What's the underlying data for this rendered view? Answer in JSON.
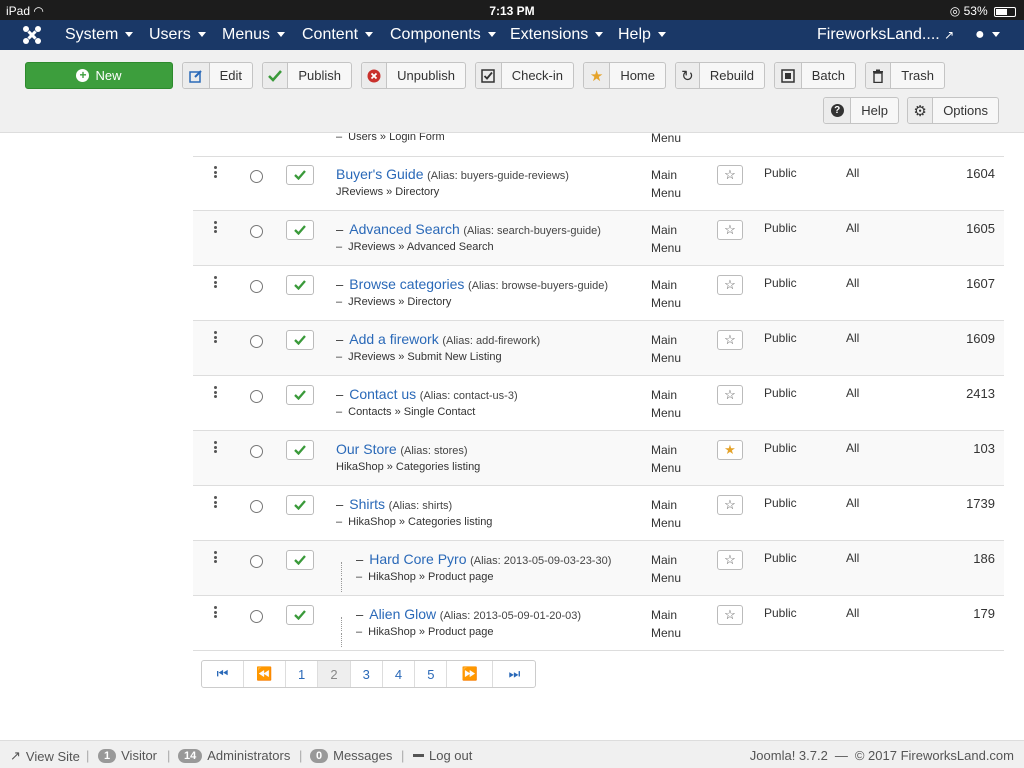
{
  "statusbar": {
    "device": "iPad",
    "time": "7:13 PM",
    "battery": "53%"
  },
  "nav": {
    "menus": [
      "System",
      "Users",
      "Menus",
      "Content",
      "Components",
      "Extensions",
      "Help"
    ],
    "site": "FireworksLand...."
  },
  "toolbar": {
    "new": "New",
    "edit": "Edit",
    "publish": "Publish",
    "unpublish": "Unpublish",
    "checkin": "Check-in",
    "home": "Home",
    "rebuild": "Rebuild",
    "batch": "Batch",
    "trash": "Trash",
    "help": "Help",
    "options": "Options"
  },
  "partial_row": {
    "sub": "Users » Login Form",
    "menu": "Menu"
  },
  "rows": [
    {
      "indent": 0,
      "title": "Buyer's Guide",
      "alias": "(Alias: buyers-guide-reviews)",
      "sub": "JReviews » Directory",
      "menu": [
        "Main",
        "Menu"
      ],
      "home": false,
      "access": "Public",
      "lang": "All",
      "id": "1604"
    },
    {
      "indent": 1,
      "title": "Advanced Search",
      "alias": "(Alias: search-buyers-guide)",
      "sub": "JReviews » Advanced Search",
      "menu": [
        "Main",
        "Menu"
      ],
      "home": false,
      "access": "Public",
      "lang": "All",
      "id": "1605"
    },
    {
      "indent": 1,
      "title": "Browse categories",
      "alias": "(Alias: browse-buyers-guide)",
      "sub": "JReviews » Directory",
      "menu": [
        "Main",
        "Menu"
      ],
      "home": false,
      "access": "Public",
      "lang": "All",
      "id": "1607"
    },
    {
      "indent": 1,
      "title": "Add a firework",
      "alias": "(Alias: add-firework)",
      "sub": "JReviews » Submit New Listing",
      "menu": [
        "Main",
        "Menu"
      ],
      "home": false,
      "access": "Public",
      "lang": "All",
      "id": "1609"
    },
    {
      "indent": 1,
      "title": "Contact us",
      "alias": "(Alias: contact-us-3)",
      "sub": "Contacts » Single Contact",
      "menu": [
        "Main",
        "Menu"
      ],
      "home": false,
      "access": "Public",
      "lang": "All",
      "id": "2413"
    },
    {
      "indent": 0,
      "title": "Our Store",
      "alias": "(Alias: stores)",
      "sub": "HikaShop » Categories listing",
      "menu": [
        "Main",
        "Menu"
      ],
      "home": true,
      "access": "Public",
      "lang": "All",
      "id": "103"
    },
    {
      "indent": 1,
      "title": "Shirts",
      "alias": "(Alias: shirts)",
      "sub": "HikaShop » Categories listing",
      "menu": [
        "Main",
        "Menu"
      ],
      "home": false,
      "access": "Public",
      "lang": "All",
      "id": "1739"
    },
    {
      "indent": 2,
      "title": "Hard Core Pyro",
      "alias": "(Alias: 2013-05-09-03-23-30)",
      "sub": "HikaShop » Product page",
      "menu": [
        "Main",
        "Menu"
      ],
      "home": false,
      "access": "Public",
      "lang": "All",
      "id": "186"
    },
    {
      "indent": 2,
      "title": "Alien Glow",
      "alias": "(Alias: 2013-05-09-01-20-03)",
      "sub": "HikaShop » Product page",
      "menu": [
        "Main",
        "Menu"
      ],
      "home": false,
      "access": "Public",
      "lang": "All",
      "id": "179"
    }
  ],
  "pagination": {
    "pages": [
      "1",
      "2",
      "3",
      "4",
      "5"
    ],
    "active": "2"
  },
  "footer": {
    "view_site": "View Site",
    "visitors_count": "1",
    "visitors": "Visitor",
    "admins_count": "14",
    "admins": "Administrators",
    "messages_count": "0",
    "messages": "Messages",
    "logout": "Log out",
    "version": "Joomla! 3.7.2",
    "copyright": "© 2017 FireworksLand.com"
  },
  "colors": {
    "navbar": "#1a3867",
    "new_button": "#3d9e3d",
    "link": "#2a69b8",
    "check": "#3a9a3a",
    "home_star": "#e5a32a"
  }
}
